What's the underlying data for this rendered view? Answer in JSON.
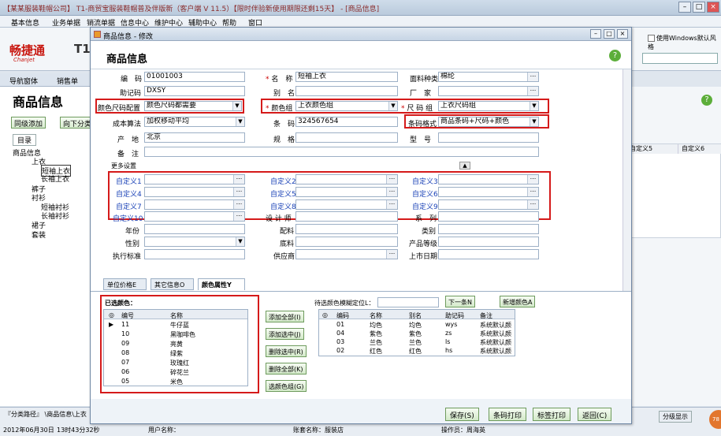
{
  "app": {
    "title": "【某某服装鞋帽公司】 T1-商贸宝服装鞋帽普及伴版新（客户端 V 11.5）【限时伴验新使用期限还剩15天】 - [商品信息]",
    "menu": [
      "基本信息",
      "业务单据",
      "销流单据",
      "信息中心",
      "维护中心",
      "辅助中心",
      "帮助",
      "窗口"
    ],
    "logo": "畅捷通",
    "logo_en": "Chanjet",
    "logo_t": "T1",
    "windows_style": "使用Windows默认风格",
    "nav_tabs": [
      "导航窗体",
      "销售单"
    ]
  },
  "left": {
    "title": "商品信息",
    "btn_add": "同级添加",
    "btn_down": "向下分类",
    "tree_tab": "目录",
    "tree": [
      "商品信息",
      "上衣",
      "短袖上衣",
      "长袖上衣",
      "裤子",
      "衬衫",
      "短袖衬衫",
      "长袖衬衫",
      "裙子",
      "套装"
    ]
  },
  "right": {
    "headers": [
      "自定义5",
      "自定义6"
    ]
  },
  "status": {
    "path": "『分类路径』 \\商品信息\\上衣",
    "date": "2012年06月30日",
    "time": "13时43分32秒",
    "user": "用户名称：",
    "acct": "账套名称：服装店",
    "operator": "操作员：周海英",
    "split": "分级显示"
  },
  "dialog": {
    "titlebar": "商品信息 - 修改",
    "title": "商品信息",
    "fields": {
      "code_l": "编　码",
      "code_v": "01001003",
      "name_l": "名　称",
      "name_v": "短袖上衣",
      "fabric_l": "面料种类",
      "fabric_v": "棉纶",
      "mnemonic_l": "助记码",
      "mnemonic_v": "DXSY",
      "alias_l": "别　名",
      "factory_l": "厂　家",
      "colorsize_l": "颜色尺码配置",
      "colorsize_v": "颜色尺码都需要",
      "colorgroup_l": "颜色组",
      "colorgroup_v": "上衣颜色组",
      "sizegroup_l": "尺 码 组",
      "sizegroup_v": "上衣尺码组",
      "cost_l": "成本算法",
      "cost_v": "加权移动平均",
      "barcode_l": "条　码",
      "barcode_v": "324567654",
      "barfmt_l": "条码格式",
      "barfmt_v": "商品条码+尺码+颜色",
      "origin_l": "产　地",
      "origin_v": "北京",
      "spec_l": "规　格",
      "model_l": "型　号",
      "remark_l": "备　注",
      "more": "更多设置",
      "custom": [
        "自定义1",
        "自定义2",
        "自定义3",
        "自定义4",
        "自定义5",
        "自定义6",
        "自定义7",
        "自定义8",
        "自定义9",
        "自定义10"
      ],
      "designer_l": "设 计 师",
      "series_l": "系　列",
      "year_l": "年份",
      "parts_l": "配料",
      "category_l": "类别",
      "gender_l": "性别",
      "bottom_l": "底料",
      "grade_l": "产品等级",
      "standard_l": "执行标准",
      "supplier_l": "供应商",
      "market_l": "上市日期"
    },
    "tabs": [
      "单位价格E",
      "其它信息O",
      "颜色属性Y"
    ],
    "selected_label": "已选颜色：",
    "selected_headers": [
      "编号",
      "名称"
    ],
    "selected_rows": [
      [
        "11",
        "牛仔蓝"
      ],
      [
        "10",
        "黑咖啡色"
      ],
      [
        "09",
        "亮黄"
      ],
      [
        "08",
        "绿紫"
      ],
      [
        "07",
        "玫瑰红"
      ],
      [
        "06",
        "碎花兰"
      ],
      [
        "05",
        "米色"
      ]
    ],
    "mid_buttons": [
      "添加全部(I)",
      "添加选中(J)",
      "删除选中(R)",
      "删除全部(K)",
      "选颜色组(G)"
    ],
    "pending_label": "待选颜色模糊定位L：",
    "next_btn": "下一条N",
    "new_color_btn": "新增颜色A",
    "pending_headers": [
      "编码",
      "名称",
      "别名",
      "助记码",
      "备注"
    ],
    "pending_rows": [
      [
        "01",
        "均色",
        "均色",
        "wys",
        "系统默认颜"
      ],
      [
        "04",
        "紫色",
        "紫色",
        "zs",
        "系统默认颜"
      ],
      [
        "03",
        "兰色",
        "兰色",
        "ls",
        "系统默认颜"
      ],
      [
        "02",
        "红色",
        "红色",
        "hs",
        "系统默认颜"
      ]
    ],
    "footer": [
      "保存(S)",
      "条码打印",
      "标签打印",
      "返回(C)"
    ]
  }
}
